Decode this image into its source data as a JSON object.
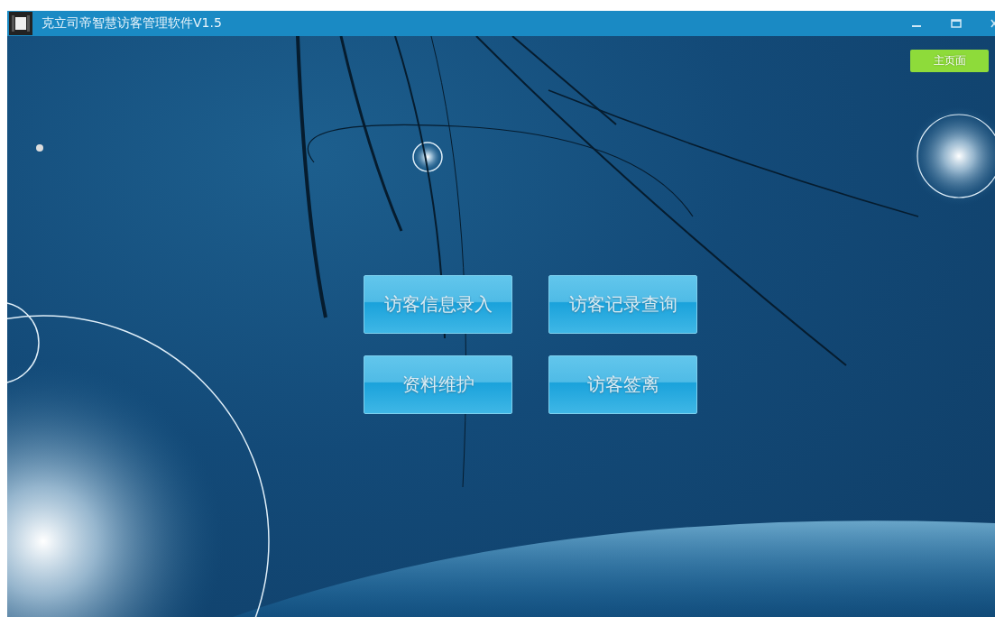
{
  "window": {
    "title": "克立司帝智慧访客管理软件V1.5"
  },
  "home_button": {
    "label": "主页面"
  },
  "menu_buttons": [
    {
      "label": "访客信息录入"
    },
    {
      "label": "访客记录查询"
    },
    {
      "label": "资料维护"
    },
    {
      "label": "访客签离"
    }
  ]
}
